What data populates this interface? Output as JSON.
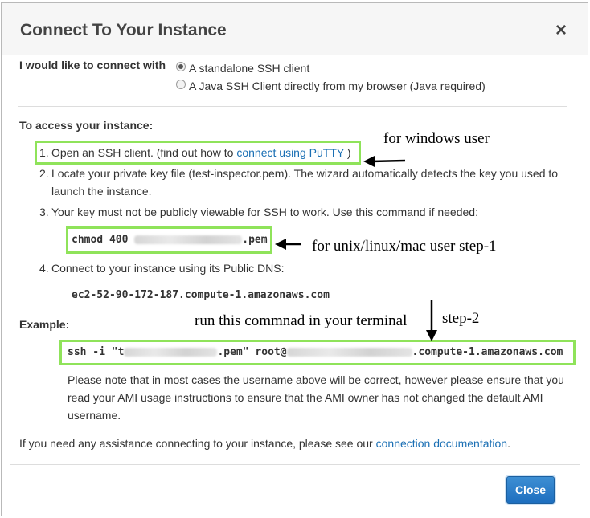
{
  "dialog": {
    "title": "Connect To Your Instance",
    "close_icon": "×"
  },
  "connect_with": {
    "label": "I would like to connect with",
    "options": [
      {
        "label": "A standalone SSH client",
        "selected": true
      },
      {
        "label": "A Java SSH Client directly from my browser (Java required)",
        "selected": false
      }
    ]
  },
  "access": {
    "heading": "To access your instance:",
    "steps": [
      {
        "num": "1.",
        "text": "Open an SSH client. (find out how to",
        "link": "connect using PuTTY",
        "after": ")"
      },
      {
        "num": "2.",
        "text_line1": "Locate your private key file (test-inspector.pem). The wizard automatically detects the key you used to",
        "text_line2": "launch the instance."
      },
      {
        "num": "3.",
        "text": "Your key must not be publicly viewable for SSH to work. Use this command if needed:"
      },
      {
        "num": "4.",
        "text": "Connect to your instance using its Public DNS:"
      }
    ],
    "chmod_prefix": "chmod 400 ",
    "chmod_suffix": ".pem",
    "public_dns": "ec2-52-90-172-187.compute-1.amazonaws.com"
  },
  "example": {
    "label": "Example:",
    "cmd_prefix": "ssh -i \"t",
    "cmd_mid": ".pem\" root@",
    "cmd_suffix": ".compute-1.amazonaws.com",
    "note_line1": "Please note that in most cases the username above will be correct, however please ensure that you",
    "note_line2": "read your AMI usage instructions to ensure that the AMI owner has not changed the default AMI",
    "note_line3": "username."
  },
  "assistance": {
    "text": "If you need any assistance connecting to your instance, please see our",
    "link": "connection documentation",
    "after": "."
  },
  "annotations": {
    "windows": "for windows user",
    "unix": "for unix/linux/mac user step-1",
    "terminal": "run this commnad in your terminal",
    "step2": "step-2"
  },
  "footer": {
    "close_label": "Close"
  },
  "colors": {
    "highlight_box": "#8fe35a",
    "link": "#1a6fb4",
    "primary_button": "#1e6fbf"
  }
}
